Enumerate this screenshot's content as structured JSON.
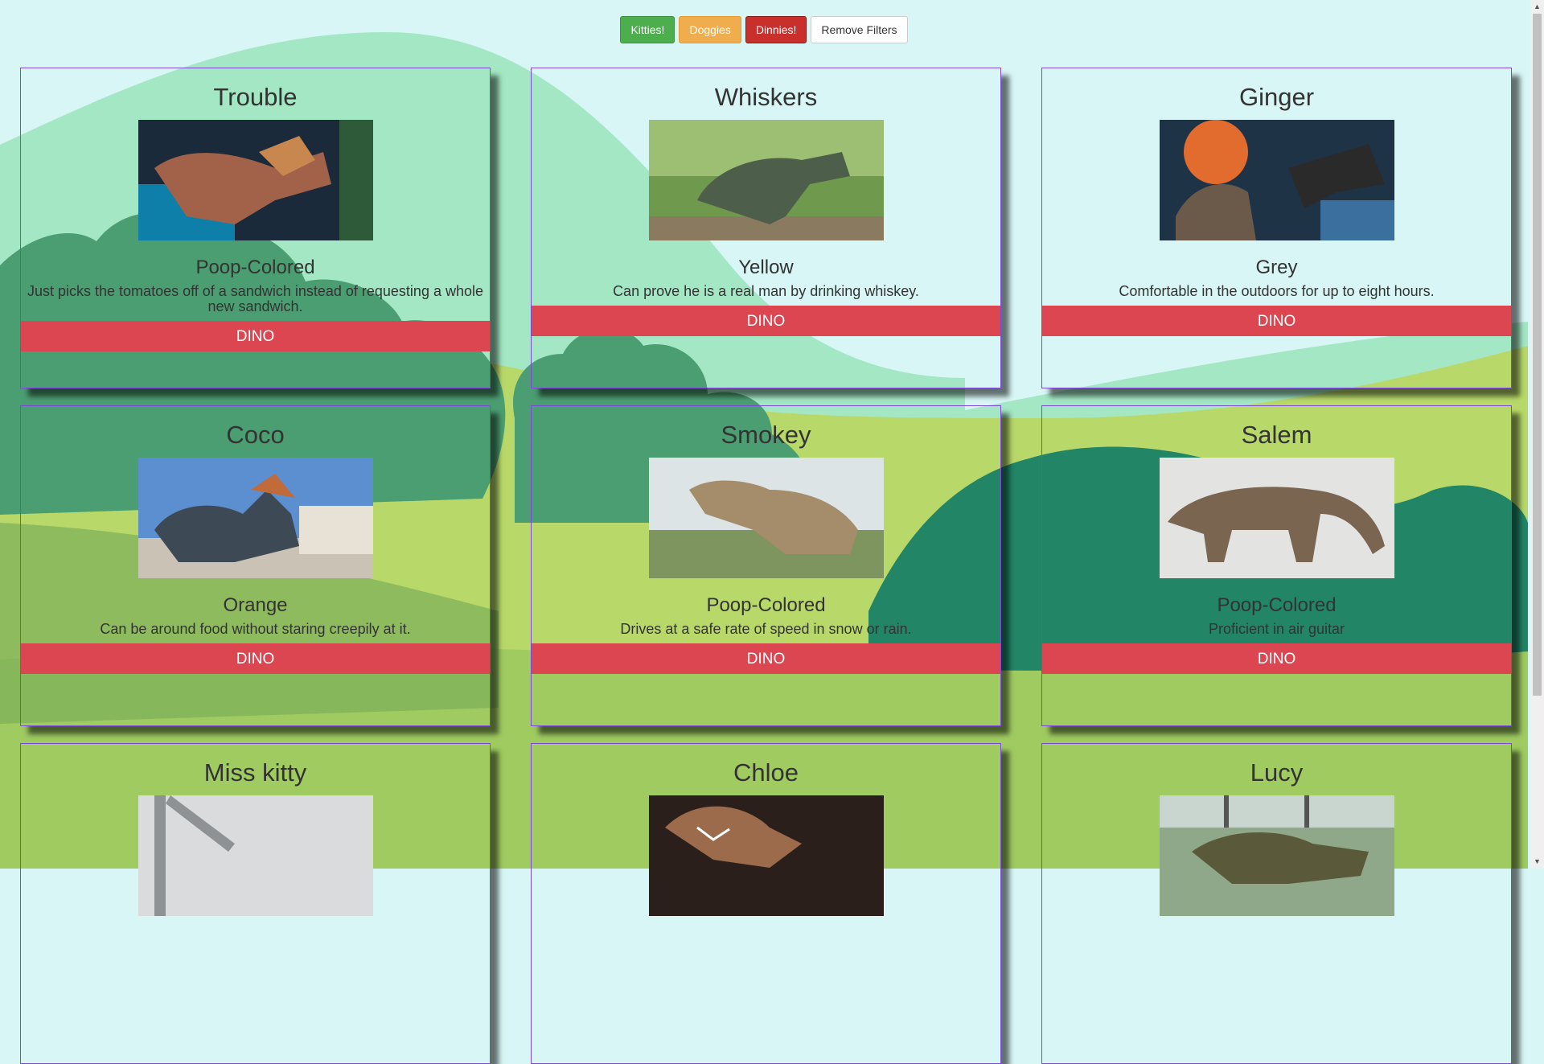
{
  "filters": {
    "kitties": "Kitties!",
    "doggies": "Doggies",
    "dinnies": "Dinnies!",
    "remove": "Remove Filters"
  },
  "cards": [
    {
      "name": "Trouble",
      "color": "Poop-Colored",
      "description": "Just picks the tomatoes off of a sandwich instead of requesting a whole new sandwich.",
      "type": "DINO"
    },
    {
      "name": "Whiskers",
      "color": "Yellow",
      "description": "Can prove he is a real man by drinking whiskey.",
      "type": "DINO"
    },
    {
      "name": "Ginger",
      "color": "Grey",
      "description": "Comfortable in the outdoors for up to eight hours.",
      "type": "DINO"
    },
    {
      "name": "Coco",
      "color": "Orange",
      "description": "Can be around food without staring creepily at it.",
      "type": "DINO"
    },
    {
      "name": "Smokey",
      "color": "Poop-Colored",
      "description": "Drives at a safe rate of speed in snow or rain.",
      "type": "DINO"
    },
    {
      "name": "Salem",
      "color": "Poop-Colored",
      "description": "Proficient in air guitar",
      "type": "DINO"
    },
    {
      "name": "Miss kitty",
      "color": "",
      "description": "",
      "type": ""
    },
    {
      "name": "Chloe",
      "color": "",
      "description": "",
      "type": ""
    },
    {
      "name": "Lucy",
      "color": "",
      "description": "",
      "type": ""
    }
  ],
  "colors": {
    "sky": "#d7f6f5",
    "hill_light": "#a3e7c4",
    "hill_dark": "#4b9d72",
    "grass": "#b8d96a",
    "card_border": "#7c49d8",
    "dino_button": "#dc4650"
  }
}
